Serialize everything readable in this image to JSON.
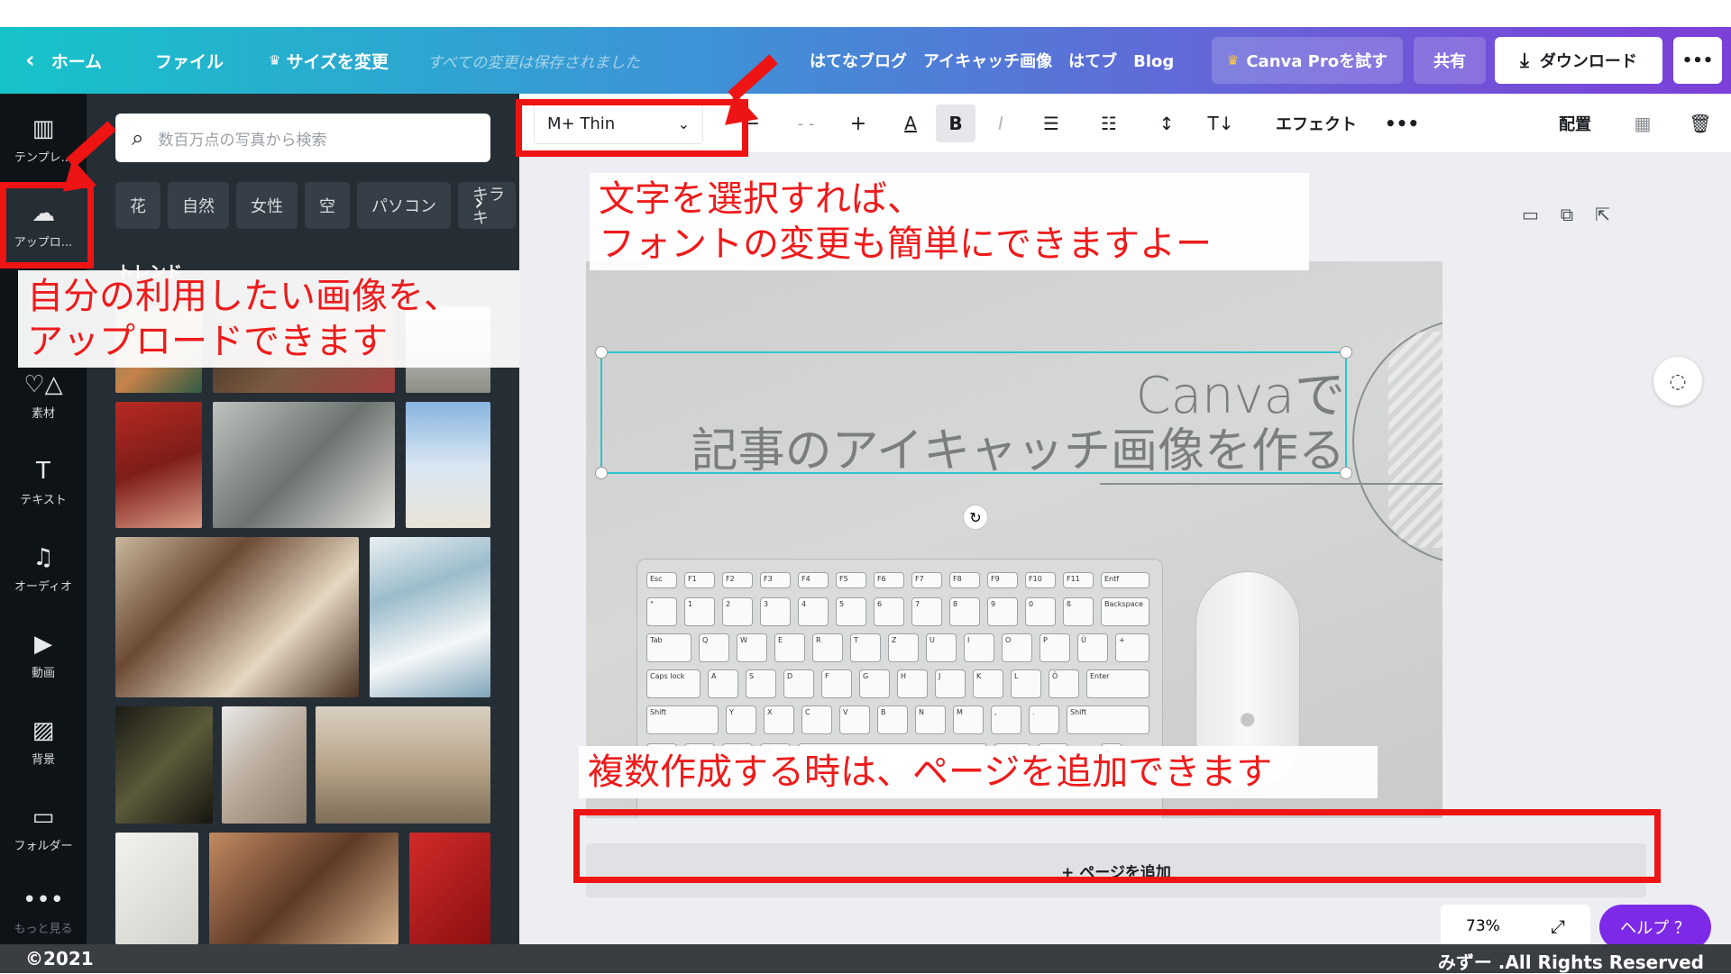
{
  "topbar": {
    "home": "ホーム",
    "file": "ファイル",
    "resize": "サイズを変更",
    "saved": "すべての変更は保存されました",
    "design_title": "はてなブログ　アイキャッチ画像　はてブ　Blog",
    "pro": "Canva Proを試す",
    "share": "共有",
    "download": "ダウンロード",
    "more": "•••"
  },
  "sidebar": {
    "items": [
      {
        "label": "テンプレ...",
        "icon": "template-icon"
      },
      {
        "label": "アップロ...",
        "icon": "upload-icon"
      },
      {
        "label": "素材",
        "icon": "elements-icon"
      },
      {
        "label": "テキスト",
        "icon": "text-icon"
      },
      {
        "label": "オーディオ",
        "icon": "audio-icon"
      },
      {
        "label": "動画",
        "icon": "video-icon"
      },
      {
        "label": "背景",
        "icon": "background-icon"
      },
      {
        "label": "フォルダー",
        "icon": "folder-icon"
      },
      {
        "label": "もっと見る",
        "icon": "more-icon"
      }
    ]
  },
  "panel": {
    "search_placeholder": "数百万点の写真から検索",
    "chips": [
      "花",
      "自然",
      "女性",
      "空",
      "パソコン",
      "キラキ"
    ],
    "section_label": "トレンド"
  },
  "toolbar": {
    "font": "M+ Thin",
    "size": "- -",
    "effects": "エフェクト",
    "more": "•••",
    "position": "配置"
  },
  "canvas": {
    "line1": "Canvaで",
    "line2": "記事のアイキャッチ画像を作る",
    "add_page": "+ ページを追加",
    "zoom": "73%",
    "help": "ヘルプ ？"
  },
  "annotations": {
    "upload_1": "自分の利用したい画像を、",
    "upload_2": "アップロードできます",
    "font_1": "文字を選択すれば、",
    "font_2": "フォントの変更も簡単にできますよー",
    "page": "複数作成する時は、ページを追加できます"
  },
  "footer": {
    "left": "©2021",
    "right": "みずー .All Rights Reserved"
  },
  "colors": {
    "accent_red": "#ee1414",
    "selection_cyan": "#2bc4cf",
    "help_purple": "#7d2ae8"
  }
}
